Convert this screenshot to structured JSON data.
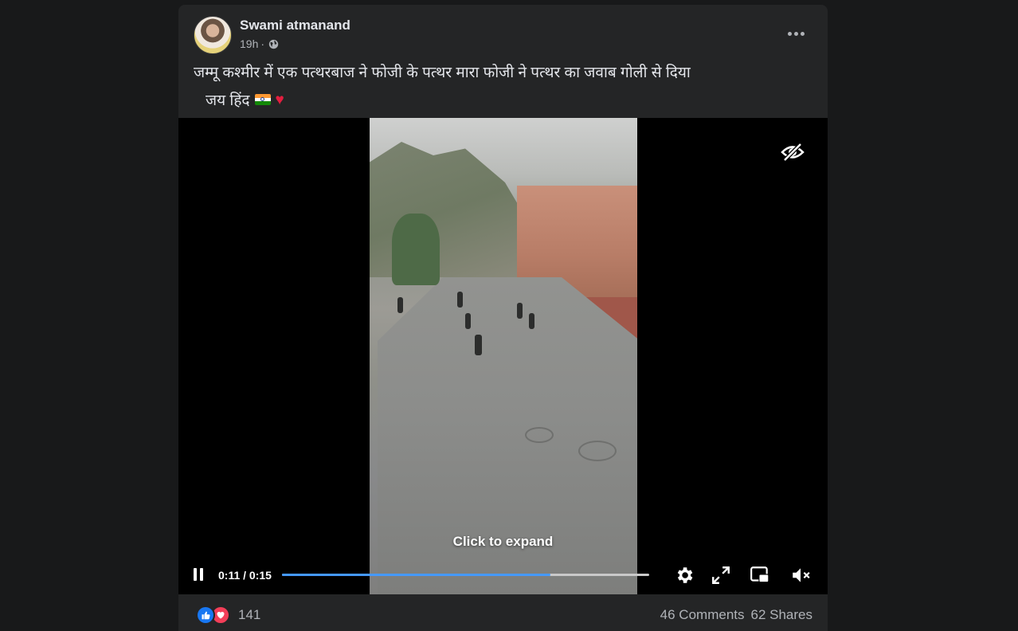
{
  "post": {
    "author": "Swami atmanand",
    "time": "19h",
    "separator": "·",
    "privacy_icon": "globe-icon",
    "more_icon": "more-options-icon",
    "text_line1": "जम्मू कश्मीर में एक पत्थरबाज ने फोजी के पत्थर मारा फोजी ने पत्थर का जवाब गोली से दिया",
    "text_line2": "जय हिंद",
    "emojis": [
      "indian-flag",
      "red-heart"
    ]
  },
  "video": {
    "overlay_label": "Click to expand",
    "current_time": "0:11",
    "duration": "0:15",
    "time_display": "0:11 / 0:15",
    "progress_fraction": 0.73,
    "controls": [
      "pause-icon",
      "settings-icon",
      "fullscreen-icon",
      "picture-in-picture-icon",
      "muted-volume-icon"
    ],
    "hide_icon": "eye-slash-icon"
  },
  "footer": {
    "reactions": [
      "like",
      "love"
    ],
    "reaction_count": "141",
    "comments": "46 Comments",
    "shares": "62 Shares"
  },
  "colors": {
    "page_bg": "#18191a",
    "card_bg": "#242526",
    "progress_fill": "#4599ff",
    "like_blue": "#1877f2",
    "love_red": "#f33e58"
  }
}
